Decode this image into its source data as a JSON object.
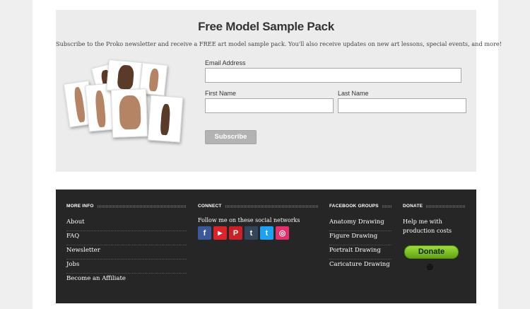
{
  "signup": {
    "title": "Free Model Sample Pack",
    "subtitle": "Subscribe to the Proko newsletter and receive a FREE art model sample pack. You'll also receive updates on new art lessons, special events, and more!",
    "email_label": "Email Address",
    "email_value": "",
    "first_name_label": "First Name",
    "first_name_value": "",
    "last_name_label": "Last Name",
    "last_name_value": "",
    "subscribe_label": "Subscribe"
  },
  "footer": {
    "more_info": {
      "heading": "MORE INFO",
      "links": [
        "About",
        "FAQ",
        "Newsletter",
        "Jobs",
        "Become an Affiliate"
      ]
    },
    "connect": {
      "heading": "CONNECT",
      "text": "Follow me on these social networks",
      "icons": [
        {
          "name": "facebook-icon",
          "glyph": "f",
          "color": "#3b5998"
        },
        {
          "name": "youtube-icon",
          "glyph": "▶",
          "color": "#d9252a"
        },
        {
          "name": "pinterest-icon",
          "glyph": "P",
          "color": "#cb2027"
        },
        {
          "name": "tumblr-icon",
          "glyph": "t",
          "color": "#35465c"
        },
        {
          "name": "twitter-icon",
          "glyph": "t",
          "color": "#1da1f2"
        },
        {
          "name": "instagram-icon",
          "glyph": "◎",
          "color": "#e1306c"
        }
      ]
    },
    "facebook_groups": {
      "heading": "FACEBOOK GROUPS",
      "links": [
        "Anatomy Drawing",
        "Figure Drawing",
        "Portrait Drawing",
        "Caricature Drawing"
      ]
    },
    "donate": {
      "heading": "DONATE",
      "text": "Help me with production costs",
      "button_label": "Donate",
      "smiley": "☻"
    }
  }
}
